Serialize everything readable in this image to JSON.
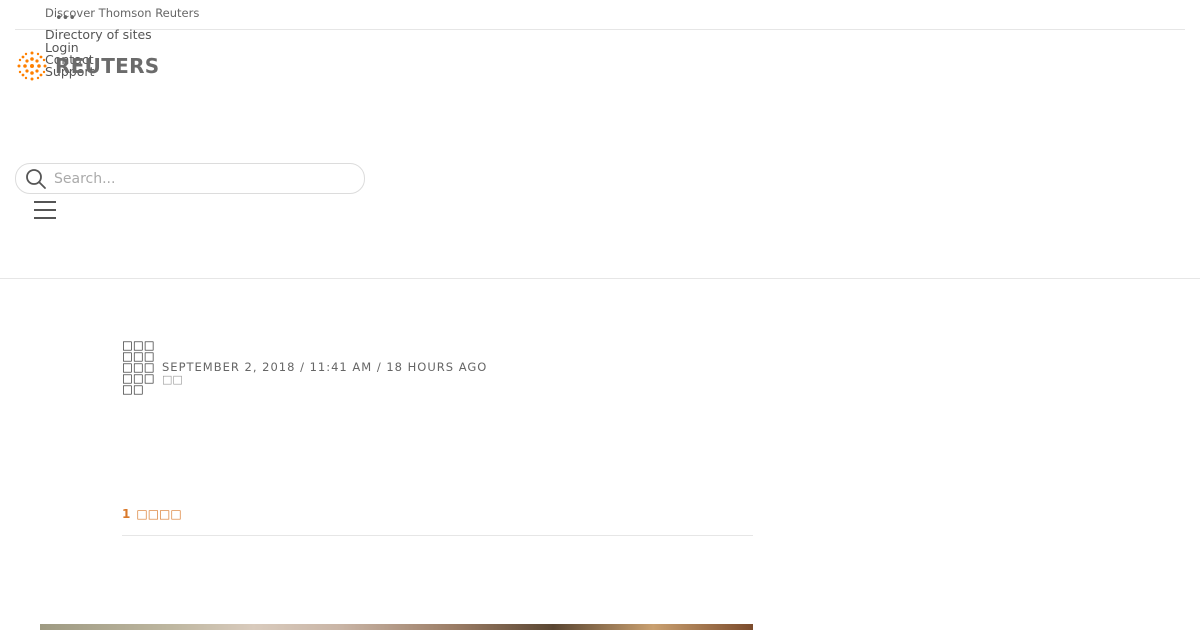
{
  "topbar": {
    "discover_label": "Discover Thomson Reuters",
    "more_icon": "ellipsis-icon",
    "links": [
      "Directory of sites",
      "Login",
      "Contact",
      "Support"
    ]
  },
  "brand": {
    "logo_text": "REUTERS",
    "accent_color": "#ff8000"
  },
  "search": {
    "placeholder": "Search..."
  },
  "article": {
    "byline": "□□□□□□□□□□□□□□",
    "dateline": "SEPTEMBER 2, 2018 / 11:41 AM / 18 HOURS AGO",
    "dateline_sub": "□□",
    "related_count": "1",
    "related_label": "□□□□"
  },
  "colors": {
    "link_orange": "#d9792b",
    "divider": "#e6e6e6"
  }
}
